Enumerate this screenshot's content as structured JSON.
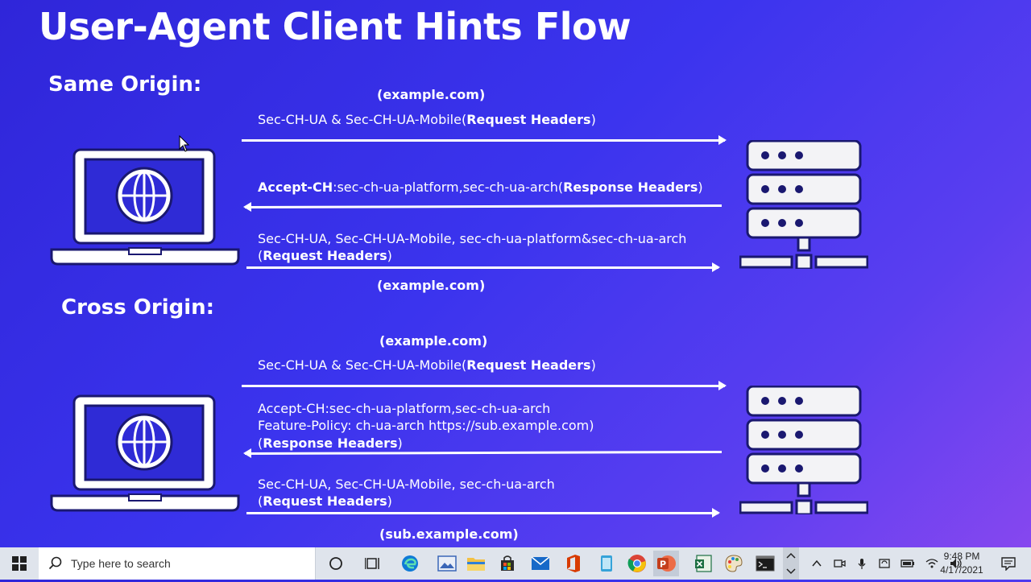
{
  "slide": {
    "title": "User-Agent Client Hints Flow",
    "same_origin": {
      "heading": "Same Origin:",
      "domain_top": "(example.com)",
      "req1_plain": "Sec-CH-UA & Sec-CH-UA-Mobile(",
      "req1_bold": "Request Headers",
      "req1_close": ")",
      "resp_bold1": "Accept-CH",
      "resp_plain": ":sec-ch-ua-platform,sec-ch-ua-arch(",
      "resp_bold2": "Response Headers",
      "resp_close": ")",
      "req2_line1": "Sec-CH-UA, Sec-CH-UA-Mobile, sec-ch-ua-platform&sec-ch-ua-arch",
      "req2_open": "(",
      "req2_bold": "Request Headers",
      "req2_close": ")",
      "domain_bottom": "(example.com)"
    },
    "cross_origin": {
      "heading": "Cross Origin:",
      "domain_top": "(example.com)",
      "req1_plain": "Sec-CH-UA & Sec-CH-UA-Mobile(",
      "req1_bold": "Request Headers",
      "req1_close": ")",
      "resp_line1": "Accept-CH:sec-ch-ua-platform,sec-ch-ua-arch",
      "resp_line2": "Feature-Policy: ch-ua-arch https://sub.example.com)",
      "resp_open": "(",
      "resp_bold": "Response Headers",
      "resp_close": ")",
      "req2_line1": "Sec-CH-UA, Sec-CH-UA-Mobile, sec-ch-ua-arch",
      "req2_open": "(",
      "req2_bold": "Request Headers",
      "req2_close": ")",
      "domain_bottom": "(sub.example.com)"
    },
    "colors": {
      "background_start": "#2f26d9",
      "background_end": "#8a48ef",
      "icon_fill": "#ffffff",
      "icon_outline": "#1a1870"
    }
  },
  "taskbar": {
    "search_placeholder": "Type here to search",
    "apps": [
      "cortana-icon",
      "task-view-icon",
      "edge-icon",
      "photos-icon",
      "file-explorer-icon",
      "store-icon",
      "mail-icon",
      "office-icon",
      "notepad-icon",
      "chrome-icon",
      "powerpoint-icon",
      "excel-icon",
      "paint-icon",
      "terminal-icon"
    ],
    "time": "9:48 PM",
    "date": "4/17/2021"
  }
}
